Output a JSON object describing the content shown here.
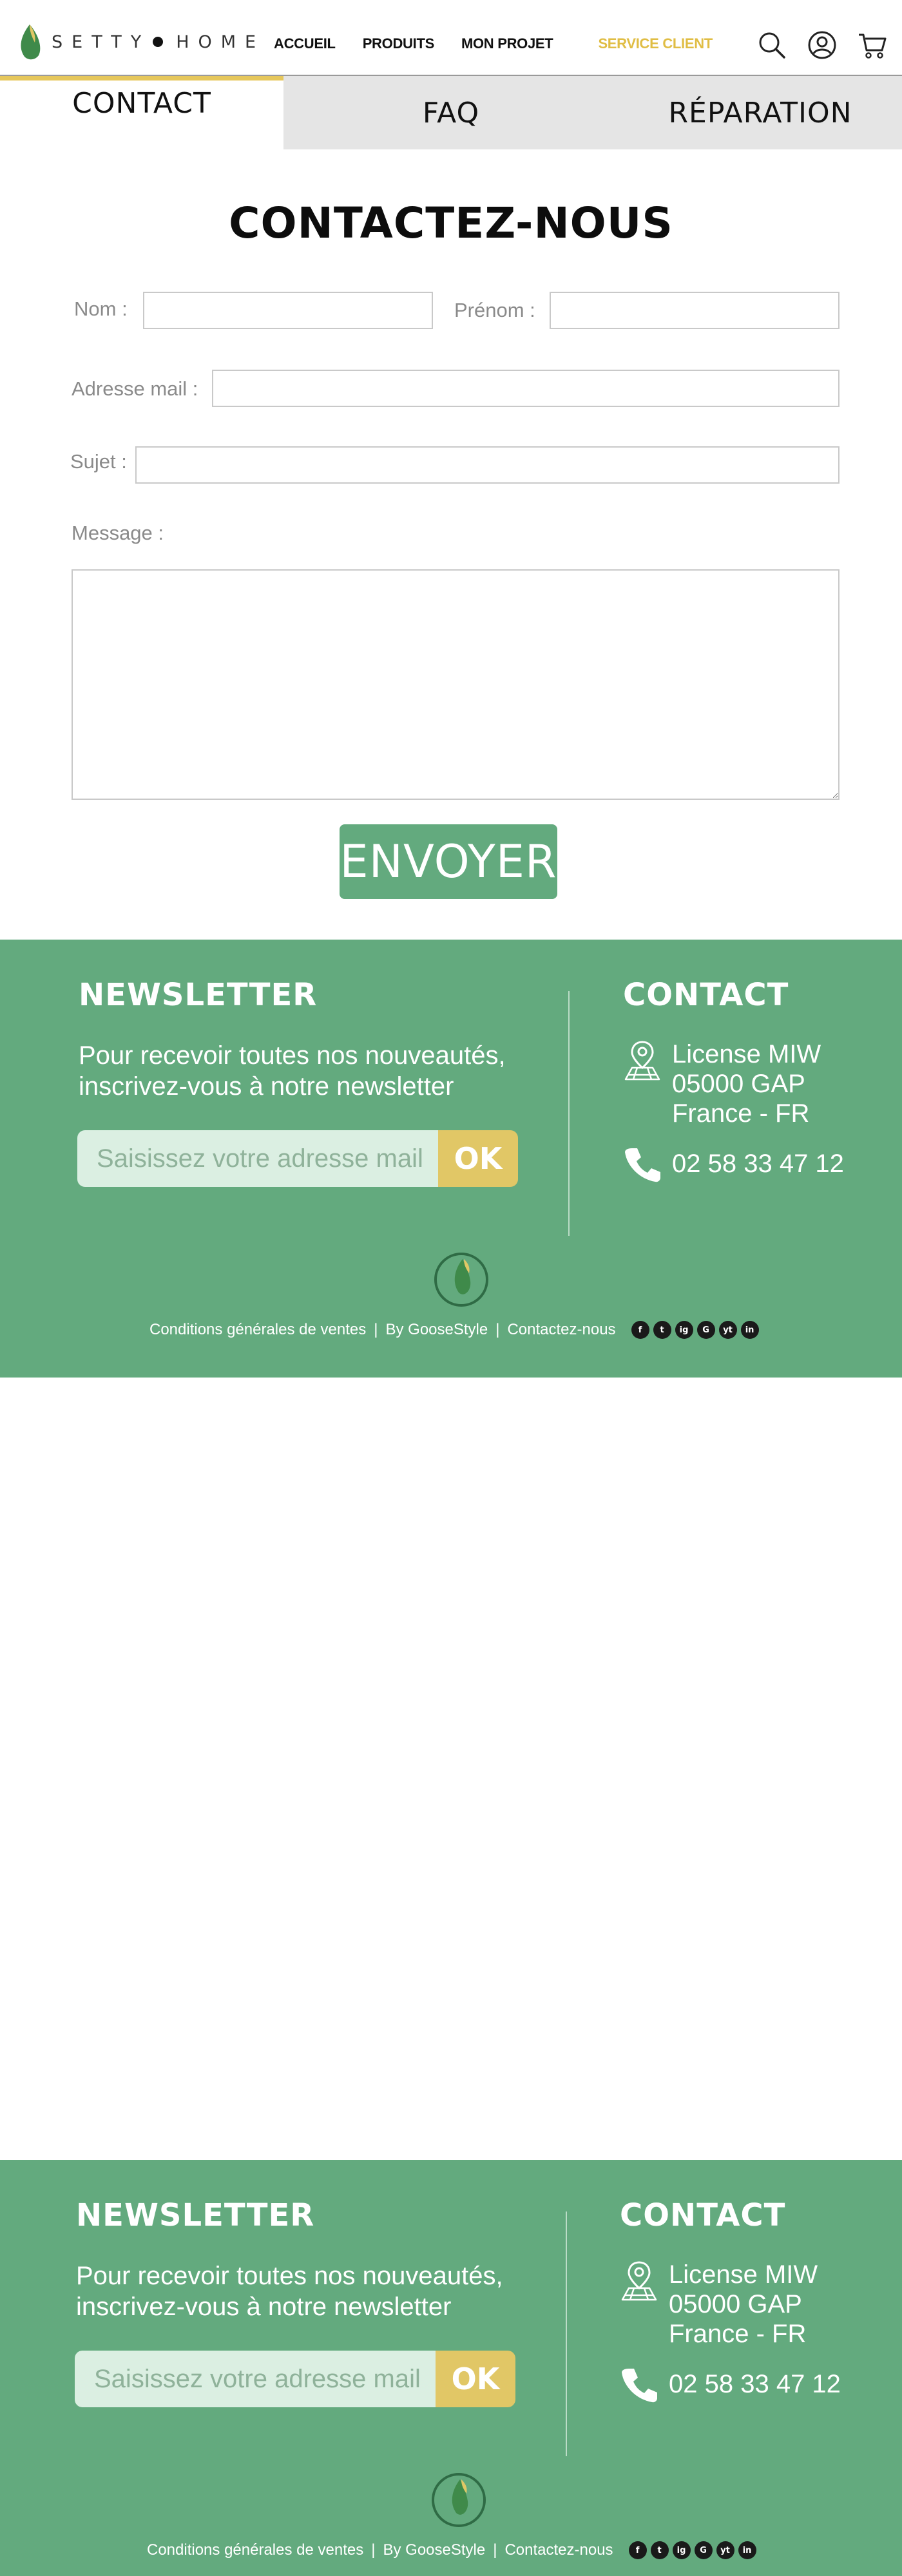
{
  "brand": {
    "name_left": "SETTY",
    "name_right": "HOME"
  },
  "nav": {
    "items": [
      {
        "label": "ACCUEIL"
      },
      {
        "label": "PRODUITS"
      },
      {
        "label": "MON PROJET"
      },
      {
        "label": "SERVICE CLIENT"
      }
    ],
    "active_color": "#e0bd44"
  },
  "header_icons": [
    "search-icon",
    "account-icon",
    "cart-icon"
  ],
  "tabs": [
    {
      "label": "CONTACT",
      "active": true
    },
    {
      "label": "FAQ"
    },
    {
      "label": "RÉPARATION"
    }
  ],
  "form": {
    "title": "CONTACTEZ-NOUS",
    "nom_label": "Nom :",
    "nom_value": "",
    "prenom_label": "Prénom :",
    "prenom_value": "",
    "email_label": "Adresse mail :",
    "email_value": "",
    "sujet_label": "Sujet :",
    "sujet_value": "",
    "message_label": "Message :",
    "message_value": "",
    "submit_label": "ENVOYER"
  },
  "footer": {
    "newsletter_title": "NEWSLETTER",
    "newsletter_text": "Pour recevoir toutes nos nouveautés, inscrivez-vous à notre newsletter",
    "newsletter_placeholder": "Saisissez votre adresse mail",
    "ok_label": "OK",
    "contact_title": "CONTACT",
    "address_line1": "License MIW",
    "address_line2": "05000 GAP",
    "address_line3": "France - FR",
    "phone": "02 58 33 47 12",
    "link_cgv": "Conditions générales de ventes",
    "link_by": "By GooseStyle",
    "link_contact": "Contactez-nous",
    "separator": "|",
    "socials": [
      "f",
      "t",
      "ig",
      "G",
      "yt",
      "in"
    ]
  },
  "colors": {
    "brand_green": "#63aa7e",
    "accent_yellow": "#e1c766",
    "tab_bg": "#e5e5e5"
  }
}
